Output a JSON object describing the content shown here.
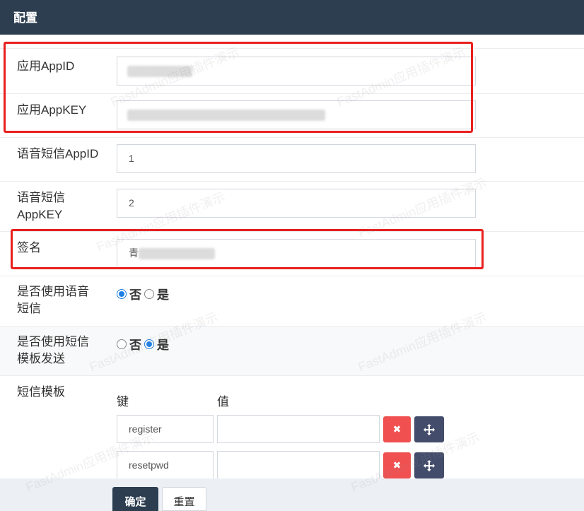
{
  "header": {
    "title": "配置"
  },
  "fields": {
    "app_id": {
      "label": "应用AppID",
      "value": "30619776"
    },
    "app_key": {
      "label": "应用AppKEY",
      "value": ""
    },
    "voice_app_id": {
      "label": "语音短信AppID",
      "value": "1"
    },
    "voice_app_key": {
      "label_line1": "语音短信",
      "label_line2": "AppKEY",
      "value": "2"
    },
    "sign": {
      "label": "签名",
      "value": "青"
    }
  },
  "use_voice": {
    "label_line1": "是否使用语音",
    "label_line2": "短信",
    "options": [
      "否",
      "是"
    ],
    "selected": "否"
  },
  "use_template": {
    "label_line1": "是否使用短信",
    "label_line2": "模板发送",
    "options": [
      "否",
      "是"
    ],
    "selected": "是"
  },
  "templates": {
    "label": "短信模板",
    "key_header": "键",
    "value_header": "值",
    "rows": [
      {
        "key": "register",
        "value": ""
      },
      {
        "key": "resetpwd",
        "value": ""
      }
    ],
    "delete_glyph": "✖"
  },
  "actions": {
    "submit": "确定",
    "reset": "重置"
  },
  "watermark": "FastAdmin应用插件演示",
  "colors": {
    "header_bg": "#2c3e50",
    "highlight": "#e8201e",
    "danger": "#f05050",
    "radio": "#1e80e6"
  }
}
